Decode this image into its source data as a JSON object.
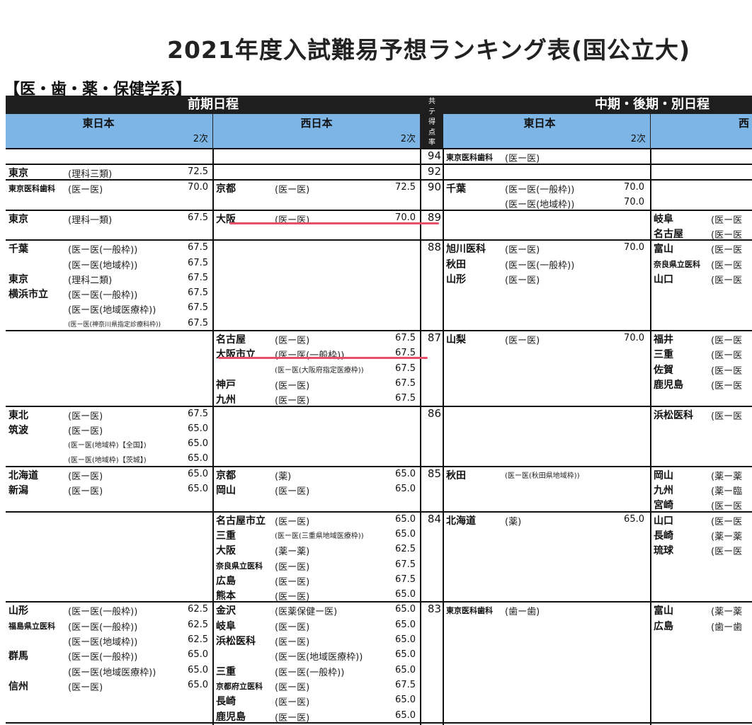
{
  "title": "2021年度入試難易予想ランキング表(国公立大)",
  "section": "【医・歯・薬・保健学系】",
  "header": {
    "zenki": "前期日程",
    "chuki": "中期・後期・別日程",
    "score_col": [
      "共",
      "テ",
      "得",
      "点",
      "率"
    ],
    "east": "東日本",
    "west": "西日本",
    "east2": "東日本",
    "west2_partial": "西",
    "niji": "2次"
  },
  "rows": [
    {
      "score": "94",
      "cells": {
        "c": [
          {
            "u": "東京医科歯科",
            "c": "(医ー医)",
            "v": ""
          }
        ]
      }
    },
    {
      "score": "92",
      "cells": {
        "a": [
          {
            "u": "東京",
            "c": "(理科三類)",
            "v": "72.5"
          }
        ]
      }
    },
    {
      "score": "90",
      "cells": {
        "a": [
          {
            "u": "東京医科歯科",
            "c": "(医ー医)",
            "v": "70.0"
          }
        ],
        "b": [
          {
            "u": "京都",
            "c": "(医ー医)",
            "v": "72.5"
          }
        ],
        "c": [
          {
            "u": "千葉",
            "c": "(医ー医(一般枠))",
            "v": "70.0"
          },
          {
            "u": "",
            "c": "(医ー医(地域枠))",
            "v": "70.0"
          }
        ]
      }
    },
    {
      "score": "89",
      "cells": {
        "a": [
          {
            "u": "東京",
            "c": "(理科一類)",
            "v": "67.5"
          }
        ],
        "b": [
          {
            "u": "大阪",
            "c": "(医ー医)",
            "v": "70.0"
          }
        ],
        "d": [
          {
            "u": "岐阜",
            "c": "(医ー医"
          },
          {
            "u": "名古屋",
            "c": "(医ー医"
          }
        ]
      }
    },
    {
      "score": "88",
      "cells": {
        "a": [
          {
            "u": "千葉",
            "c": "(医ー医(一般枠))",
            "v": "67.5"
          },
          {
            "u": "",
            "c": "(医ー医(地域枠))",
            "v": "67.5"
          },
          {
            "u": "東京",
            "c": "(理科二類)",
            "v": "67.5"
          },
          {
            "u": "横浜市立",
            "c": "(医ー医(一般枠))",
            "v": "67.5"
          },
          {
            "u": "",
            "c": "(医ー医(地域医療枠))",
            "v": "67.5"
          },
          {
            "u": "",
            "c": "(医ー医(神奈川県指定診療科枠))",
            "v": "67.5"
          }
        ],
        "c": [
          {
            "u": "旭川医科",
            "c": "(医ー医)",
            "v": "70.0"
          },
          {
            "u": "秋田",
            "c": "(医ー医(一般枠))",
            "v": ""
          },
          {
            "u": "山形",
            "c": "(医ー医)",
            "v": ""
          }
        ],
        "d": [
          {
            "u": "富山",
            "c": "(医ー医"
          },
          {
            "u": "奈良県立医科",
            "c": "(医ー医"
          },
          {
            "u": "山口",
            "c": "(医ー医"
          }
        ]
      }
    },
    {
      "score": "87",
      "cells": {
        "b": [
          {
            "u": "名古屋",
            "c": "(医ー医)",
            "v": "67.5"
          },
          {
            "u": "大阪市立",
            "c": "(医ー医(一般枠))",
            "v": "67.5"
          },
          {
            "u": "",
            "c": "(医ー医(大阪府指定医療枠))",
            "v": "67.5"
          },
          {
            "u": "神戸",
            "c": "(医ー医)",
            "v": "67.5"
          },
          {
            "u": "九州",
            "c": "(医ー医)",
            "v": "67.5"
          }
        ],
        "c": [
          {
            "u": "山梨",
            "c": "(医ー医)",
            "v": "70.0"
          }
        ],
        "d": [
          {
            "u": "福井",
            "c": "(医ー医"
          },
          {
            "u": "三重",
            "c": "(医ー医"
          },
          {
            "u": "佐賀",
            "c": "(医ー医"
          },
          {
            "u": "鹿児島",
            "c": "(医ー医"
          }
        ]
      }
    },
    {
      "score": "86",
      "cells": {
        "a": [
          {
            "u": "東北",
            "c": "(医ー医)",
            "v": "67.5"
          },
          {
            "u": "筑波",
            "c": "(医ー医)",
            "v": "65.0"
          },
          {
            "u": "",
            "c": "(医ー医(地域枠)【全国】)",
            "v": "65.0"
          },
          {
            "u": "",
            "c": "(医ー医(地域枠)【茨城】)",
            "v": "65.0"
          }
        ],
        "d": [
          {
            "u": "浜松医科",
            "c": "(医ー医"
          }
        ]
      }
    },
    {
      "score": "85",
      "cells": {
        "a": [
          {
            "u": "北海道",
            "c": "(医ー医)",
            "v": "65.0"
          },
          {
            "u": "新潟",
            "c": "(医ー医)",
            "v": "65.0"
          }
        ],
        "b": [
          {
            "u": "京都",
            "c": "(薬)",
            "v": "65.0"
          },
          {
            "u": "岡山",
            "c": "(医ー医)",
            "v": "65.0"
          }
        ],
        "c": [
          {
            "u": "秋田",
            "c": "(医ー医(秋田県地域枠))",
            "v": ""
          }
        ],
        "d": [
          {
            "u": "岡山",
            "c": "(薬ー薬"
          },
          {
            "u": "九州",
            "c": "(薬ー臨"
          },
          {
            "u": "宮崎",
            "c": "(医ー医"
          }
        ]
      }
    },
    {
      "score": "84",
      "cells": {
        "b": [
          {
            "u": "名古屋市立",
            "c": "(医ー医)",
            "v": "65.0"
          },
          {
            "u": "三重",
            "c": "(医ー医(三重県地域医療枠))",
            "v": "65.0"
          },
          {
            "u": "大阪",
            "c": "(薬ー薬)",
            "v": "62.5"
          },
          {
            "u": "奈良県立医科",
            "c": "(医ー医)",
            "v": "67.5"
          },
          {
            "u": "広島",
            "c": "(医ー医)",
            "v": "67.5"
          },
          {
            "u": "熊本",
            "c": "(医ー医)",
            "v": "65.0"
          }
        ],
        "c": [
          {
            "u": "北海道",
            "c": "(薬)",
            "v": "65.0"
          }
        ],
        "d": [
          {
            "u": "山口",
            "c": "(医ー医"
          },
          {
            "u": "長崎",
            "c": "(薬ー薬"
          },
          {
            "u": "琉球",
            "c": "(医ー医"
          }
        ]
      }
    },
    {
      "score": "83",
      "cells": {
        "a": [
          {
            "u": "山形",
            "c": "(医ー医(一般枠))",
            "v": "62.5"
          },
          {
            "u": "福島県立医科",
            "c": "(医ー医(一般枠))",
            "v": "62.5"
          },
          {
            "u": "",
            "c": "(医ー医(地域枠))",
            "v": "62.5"
          },
          {
            "u": "群馬",
            "c": "(医ー医(一般枠))",
            "v": "65.0"
          },
          {
            "u": "",
            "c": "(医ー医(地域医療枠))",
            "v": "65.0"
          },
          {
            "u": "信州",
            "c": "(医ー医)",
            "v": "65.0"
          }
        ],
        "b": [
          {
            "u": "金沢",
            "c": "(医薬保健ー医)",
            "v": "65.0"
          },
          {
            "u": "岐阜",
            "c": "(医ー医)",
            "v": "65.0"
          },
          {
            "u": "浜松医科",
            "c": "(医ー医)",
            "v": "65.0"
          },
          {
            "u": "",
            "c": "(医ー医(地域医療枠))",
            "v": "65.0"
          },
          {
            "u": "三重",
            "c": "(医ー医(一般枠))",
            "v": "65.0"
          },
          {
            "u": "京都府立医科",
            "c": "(医ー医)",
            "v": "67.5"
          },
          {
            "u": "長崎",
            "c": "(医ー医)",
            "v": "65.0"
          },
          {
            "u": "鹿児島",
            "c": "(医ー医)",
            "v": "65.0"
          }
        ],
        "c": [
          {
            "u": "東京医科歯科",
            "c": "(歯ー歯)",
            "v": ""
          }
        ],
        "d": [
          {
            "u": "富山",
            "c": "(薬ー薬"
          },
          {
            "u": "広島",
            "c": "(歯ー歯"
          }
        ]
      }
    }
  ]
}
